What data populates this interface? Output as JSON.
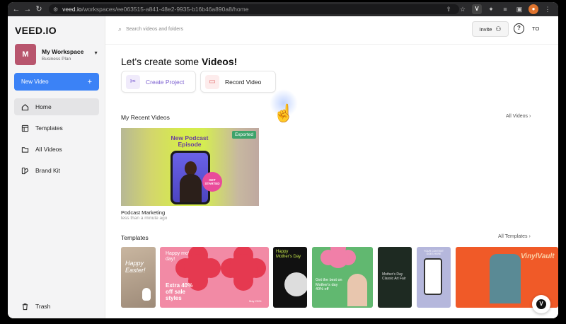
{
  "browser": {
    "url_host": "veed.io",
    "url_path": "/workspaces/ee063515-a841-48e2-9935-b16b46a890a8/home"
  },
  "sidebar": {
    "logo": "VEED.IO",
    "workspace": {
      "avatar": "M",
      "name": "My Workspace",
      "plan": "Business Plan"
    },
    "new_video": "New Video",
    "items": [
      {
        "label": "Home",
        "icon": "home-icon",
        "active": true
      },
      {
        "label": "Templates",
        "icon": "templates-icon"
      },
      {
        "label": "All Videos",
        "icon": "folder-icon"
      },
      {
        "label": "Brand Kit",
        "icon": "brand-kit-icon"
      }
    ],
    "trash": "Trash"
  },
  "topbar": {
    "search_placeholder": "Search videos and folders",
    "invite": "Invite",
    "user": "TO"
  },
  "main": {
    "hero_prefix": "Let's create some ",
    "hero_bold": "Videos!",
    "create_project": "Create Project",
    "record_video": "Record Video",
    "recent_title": "My Recent Videos",
    "all_videos_link": "All Videos",
    "video": {
      "name": "Podcast Marketing",
      "time": "less than a minute ago",
      "badge": "Exported",
      "thumb_title": "New Podcast Episode",
      "thumb_badge": "GET STARTED"
    },
    "templates_title": "Templates",
    "all_templates_link": "All Templates",
    "templates": [
      {
        "text": "Happy Easter!"
      },
      {
        "text": "Happy mother's day!",
        "sub": "Extra 40% off sale styles",
        "footer": "May 2024"
      },
      {
        "text": "Happy Mother's Day"
      },
      {
        "text": "Get the best on Mother's day 40% off"
      },
      {
        "text": "Mother's Day Classic Art Fair"
      },
      {
        "text": "YOUR CONTENT GOES HERE"
      },
      {
        "text": "VinylVault"
      }
    ]
  },
  "colors": {
    "accent": "#3b82f6",
    "workspace_avatar": "#b8556d",
    "exported": "#3da36b"
  }
}
